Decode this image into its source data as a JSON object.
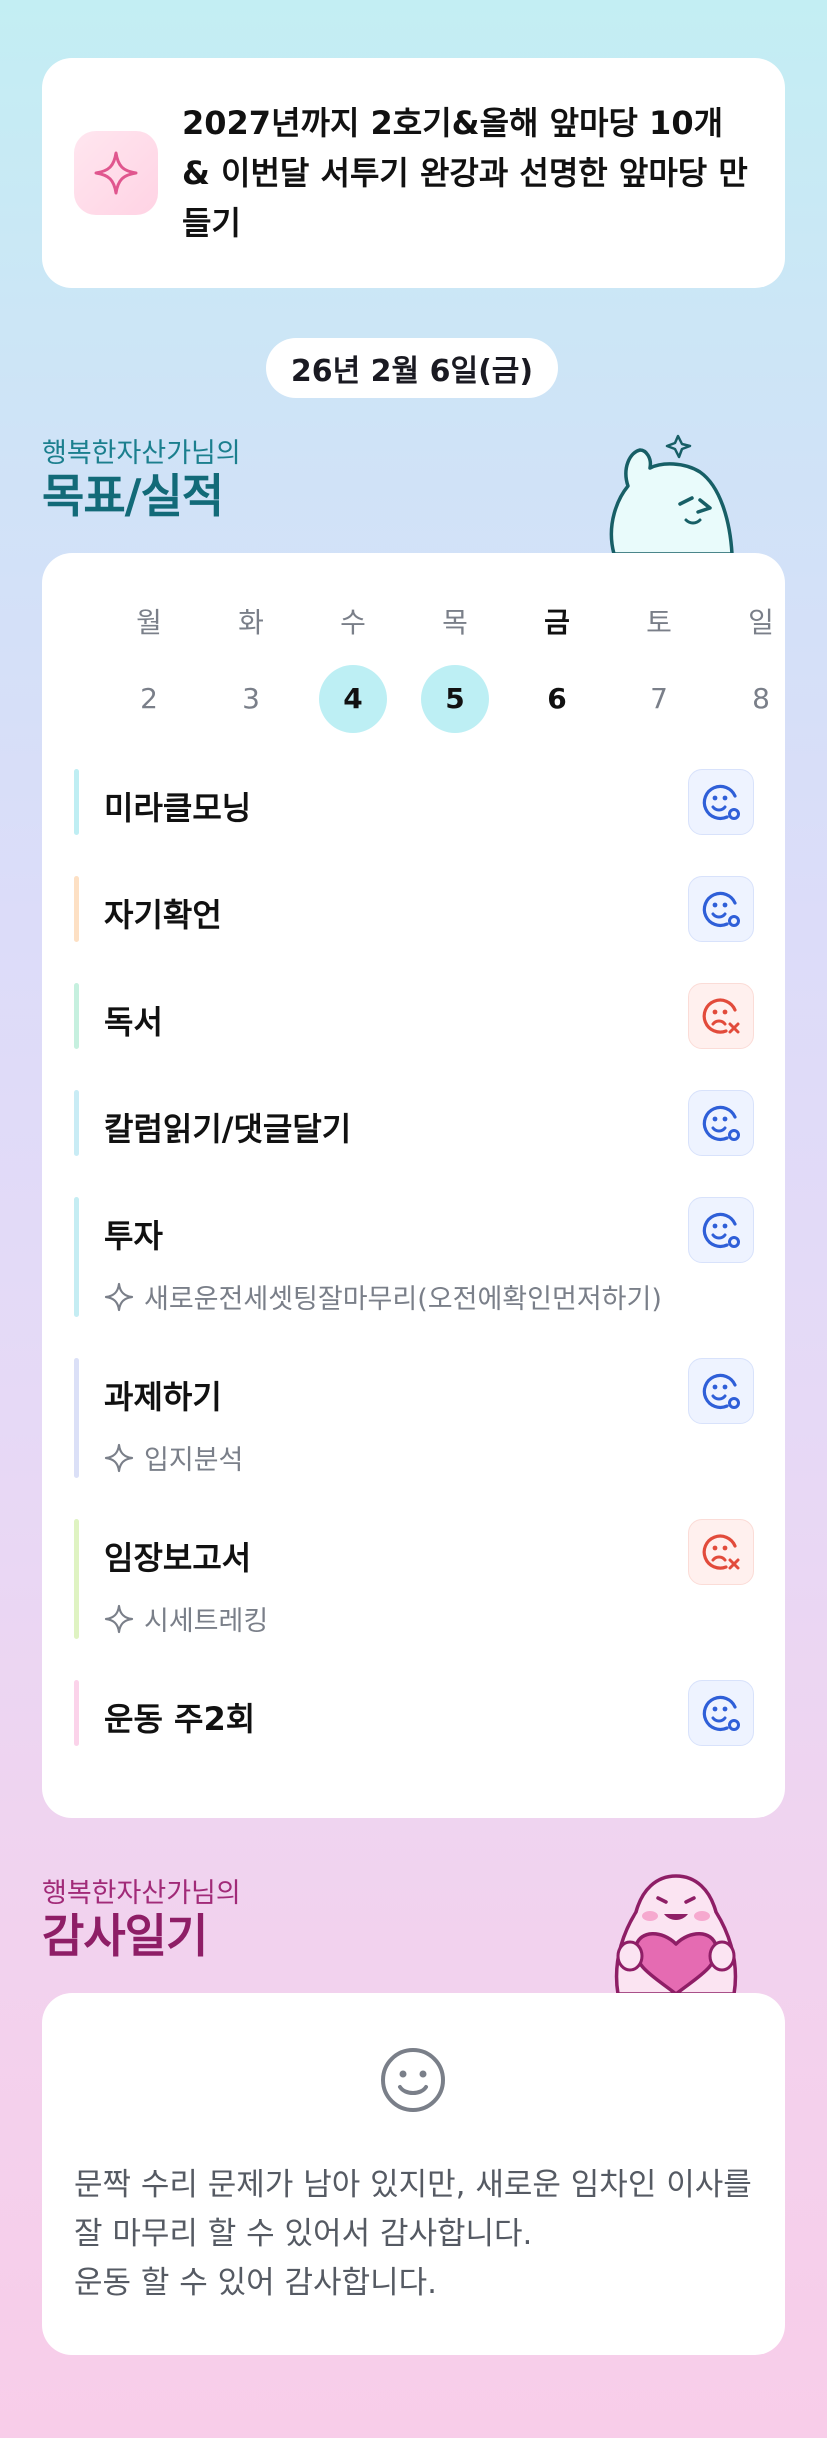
{
  "goal_banner": {
    "icon": "sparkle-icon",
    "text": "2027년까지 2호기&올해 앞마당 10개 & 이번달 서투기 완강과 선명한 앞마당 만들기"
  },
  "date_label": "26년 2월 6일(금)",
  "goals_section": {
    "subtitle": "행복한자산가님의",
    "title": "목표/실적"
  },
  "week": {
    "days": [
      {
        "name": "월",
        "num": "2",
        "state": "none"
      },
      {
        "name": "화",
        "num": "3",
        "state": "none"
      },
      {
        "name": "수",
        "num": "4",
        "state": "done"
      },
      {
        "name": "목",
        "num": "5",
        "state": "done"
      },
      {
        "name": "금",
        "num": "6",
        "state": "today"
      },
      {
        "name": "토",
        "num": "7",
        "state": "none"
      },
      {
        "name": "일",
        "num": "8",
        "state": "none"
      }
    ]
  },
  "goals": [
    {
      "title": "미라클모닝",
      "sub": "",
      "status": "achieved",
      "bar_color": "#bfeef3"
    },
    {
      "title": "자기확언",
      "sub": "",
      "status": "achieved",
      "bar_color": "#fde0c4"
    },
    {
      "title": "독서",
      "sub": "",
      "status": "missed",
      "bar_color": "#c6f0df"
    },
    {
      "title": "칼럼읽기/댓글달기",
      "sub": "",
      "status": "achieved",
      "bar_color": "#c9ecf5"
    },
    {
      "title": "투자",
      "sub": "새로운전세셋팅잘마무리(오전에확인먼저하기)",
      "status": "achieved",
      "bar_color": "#c5edf3"
    },
    {
      "title": "과제하기",
      "sub": "입지분석",
      "status": "achieved",
      "bar_color": "#dbe0f7"
    },
    {
      "title": "임장보고서",
      "sub": "시세트레킹",
      "status": "missed",
      "bar_color": "#dff3c2"
    },
    {
      "title": "운동 주2회",
      "sub": "",
      "status": "achieved",
      "bar_color": "#fbd3ea"
    }
  ],
  "status_colors": {
    "achieved": "#2f5fd8",
    "missed": "#e24b3b"
  },
  "thanks_section": {
    "subtitle": "행복한자산가님의",
    "title": "감사일기",
    "icon": "smile-icon",
    "text": "문짝 수리 문제가 남아 있지만, 새로운 임차인 이사를 잘 마무리 할 수 있어서 감사합니다.\n운동 할 수 있어 감사합니다."
  }
}
